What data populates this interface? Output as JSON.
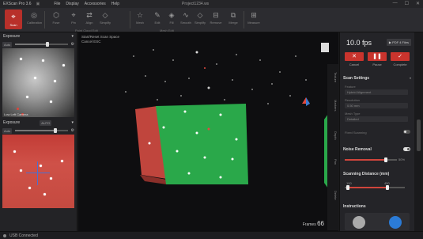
{
  "titlebar": {
    "app": "EXScan Pro 3.6",
    "menus": [
      "File",
      "Display",
      "Accessories",
      "Help"
    ],
    "project": "Project1234.ws",
    "controls": [
      "—",
      "☐",
      "✕"
    ]
  },
  "toolbar": {
    "scan_label": "Scan",
    "tools": [
      "Calibration",
      "Fuse",
      "Pin",
      "Align",
      "Simplify",
      "Mesh",
      "Edit",
      "Fill",
      "Smooth",
      "Simplify",
      "Remove",
      "Merge",
      "Measure"
    ],
    "group_labels": {
      "point_cloud": "Point Cloud Edit",
      "mesh": "Mesh Edit"
    }
  },
  "left_panel": {
    "exposure_title": "Exposure",
    "exposure_mode": "Auto",
    "camera1_caption": "Low Left Camera",
    "exposure2_label": "Exposure",
    "exposure2_mode": "AUTO",
    "exposure2_chip": "Auto"
  },
  "viewport": {
    "info_line1": "Start/Reset Scan  Space",
    "info_line2": "Cancel  ESC",
    "frames_label": "Frames",
    "frames_value": "66",
    "side_tabs": [
      "Texture",
      "Markers",
      "Depth",
      "Pan",
      "Delete"
    ]
  },
  "right_panel": {
    "fps": "10.0 fps",
    "fps_button": "▶ PDF 4 Files",
    "buttons": [
      {
        "icon": "✕",
        "label": "Cancel"
      },
      {
        "icon": "❚❚",
        "label": "Pause"
      },
      {
        "icon": "✓",
        "label": "Complete"
      }
    ],
    "scan_settings_title": "Scan Settings",
    "fields": [
      {
        "label": "Feature",
        "value": "Hybrid Alignment"
      },
      {
        "label": "Resolution",
        "value": "0.50 mm"
      },
      {
        "label": "Mesh Type",
        "value": "Detailed"
      }
    ],
    "fixed_scanning": "Fixed Scanning",
    "noise_removal_title": "Noise Removal",
    "noise_value": "50%",
    "scan_distance_title": "Scanning Distance (mm)",
    "dist_min": "100",
    "dist_max": "450",
    "instructions_title": "Instructions"
  },
  "status": {
    "text": "USB Connected"
  },
  "colors": {
    "accent": "#c9342d",
    "green_scan": "#2aa84a",
    "red_scan": "#c9463d"
  }
}
